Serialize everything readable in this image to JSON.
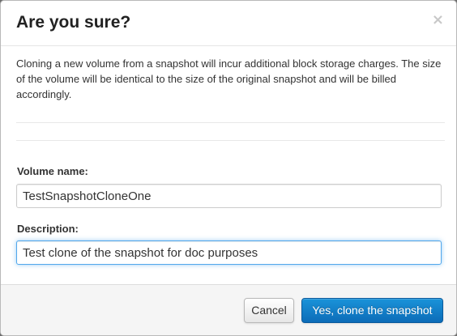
{
  "dialog": {
    "title": "Are you sure?",
    "close_symbol": "×",
    "message": "Cloning a new volume from a snapshot will incur additional block storage charges. The size of the volume will be identical to the size of the original snapshot and will be billed accordingly."
  },
  "form": {
    "volume_name": {
      "label": "Volume name:",
      "value": "TestSnapshotCloneOne"
    },
    "description": {
      "label": "Description:",
      "value": "Test clone of the snapshot for doc purposes"
    }
  },
  "footer": {
    "cancel_label": "Cancel",
    "confirm_label": "Yes, clone the snapshot"
  },
  "colors": {
    "primary_button": "#0c6cb8",
    "focus_ring": "#52a8ec"
  },
  "icons": {
    "close": "close-icon"
  }
}
